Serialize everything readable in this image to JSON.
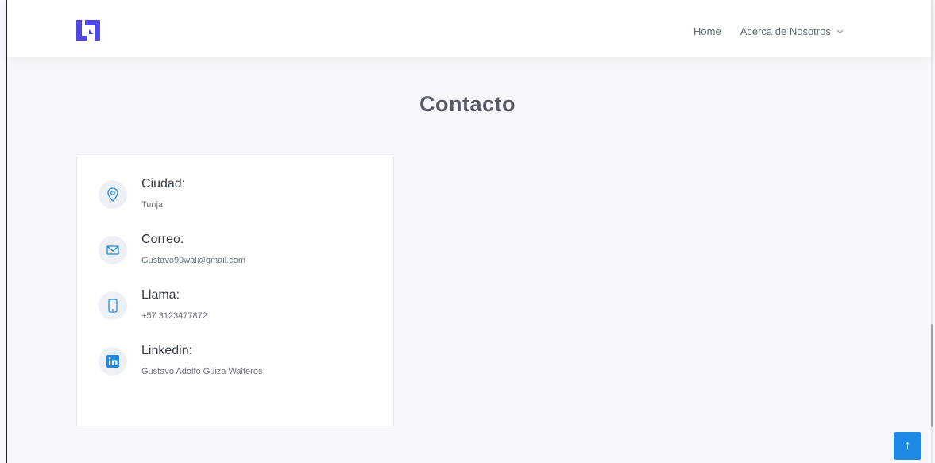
{
  "header": {
    "logo_icon": "brand-logo",
    "nav": {
      "home_label": "Home",
      "about_label": "Acerca de Nosotros",
      "about_icon": "chevron-down-icon"
    }
  },
  "main": {
    "title": "Contacto",
    "contact": {
      "items": [
        {
          "icon": "map-pin-icon",
          "label": "Ciudad:",
          "value": "Tunja"
        },
        {
          "icon": "envelope-icon",
          "label": "Correo:",
          "value": "Gustavo99wal@gmail.com"
        },
        {
          "icon": "phone-icon",
          "label": "Llama:",
          "value": "+57 3123477872"
        },
        {
          "icon": "linkedin-icon",
          "label": "Linkedin:",
          "value": "Gustavo Adolfo Güiza Walteros"
        }
      ]
    }
  },
  "scroll_top": {
    "icon": "arrow-up-icon",
    "glyph": "↑"
  },
  "colors": {
    "accent": "#1e88e5",
    "logo": "#4f46e5",
    "page_background": "#f5f7fa"
  }
}
